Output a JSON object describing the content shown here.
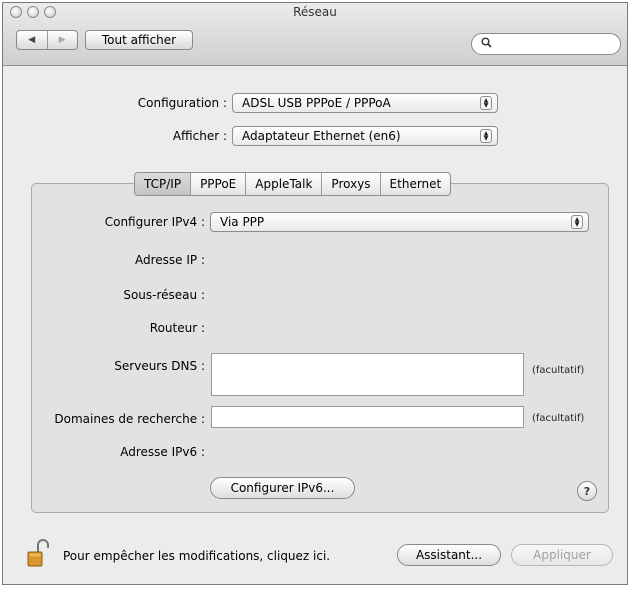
{
  "window": {
    "title": "Réseau",
    "show_all_label": "Tout afficher",
    "nav_back_icon": "◀",
    "nav_forward_icon": "▶",
    "search_icon": "search-icon",
    "search_value": ""
  },
  "config": {
    "configuration_label": "Configuration :",
    "configuration_value": "ADSL USB PPPoE / PPPoA",
    "show_label": "Afficher :",
    "show_value": "Adaptateur Ethernet (en6)"
  },
  "tabs": [
    "TCP/IP",
    "PPPoE",
    "AppleTalk",
    "Proxys",
    "Ethernet"
  ],
  "active_tab": "TCP/IP",
  "tcpip": {
    "configure_ipv4_label": "Configurer IPv4 :",
    "configure_ipv4_value": "Via PPP",
    "ip_address_label": "Adresse IP :",
    "subnet_label": "Sous-réseau :",
    "router_label": "Routeur :",
    "dns_label": "Serveurs DNS :",
    "dns_value": "",
    "dns_optional": "(facultatif)",
    "search_domains_label": "Domaines de recherche :",
    "search_domains_value": "",
    "search_domains_optional": "(facultatif)",
    "ipv6_label": "Adresse IPv6 :",
    "configure_ipv6_button": "Configurer IPv6...",
    "help_label": "?"
  },
  "footer": {
    "lock_text": "Pour empêcher les modifications, cliquez ici.",
    "assistant_button": "Assistant...",
    "apply_button": "Appliquer"
  },
  "colors": {
    "window_bg": "#ececec",
    "panel_bg": "#e2e2e2",
    "lock_gold": "#d9962b"
  }
}
